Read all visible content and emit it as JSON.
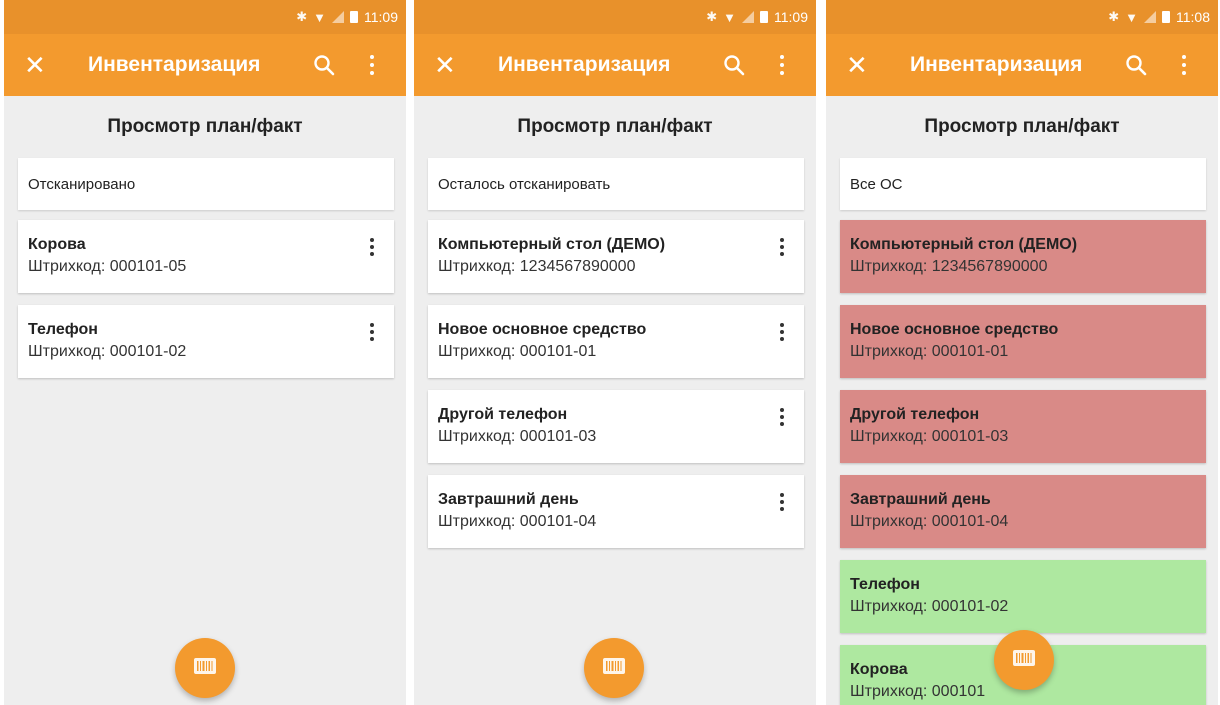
{
  "common": {
    "status_time_1": "11:09",
    "status_time_2": "11:09",
    "status_time_3": "11:08",
    "app_title": "Инвентаризация",
    "subtitle": "Просмотр план/факт",
    "icons": [
      "bluetooth-icon",
      "wifi-icon",
      "no-signal-icon",
      "battery-icon",
      "close-icon",
      "search-icon",
      "more-vert-icon",
      "barcode-scan-icon"
    ],
    "colors": {
      "accent": "#f39a2e",
      "statusbar": "#e8912b",
      "missing": "#d98a87",
      "found": "#aee8a0"
    }
  },
  "screen1": {
    "filter": "Отсканировано",
    "items": [
      {
        "name": "Корова",
        "code": "Штрихкод: 000101-05"
      },
      {
        "name": "Телефон",
        "code": "Штрихкод: 000101-02"
      }
    ]
  },
  "screen2": {
    "filter": "Осталось отсканировать",
    "items": [
      {
        "name": "Компьютерный стол (ДЕМО)",
        "code": "Штрихкод: 1234567890000"
      },
      {
        "name": "Новое основное средство",
        "code": "Штрихкод: 000101-01"
      },
      {
        "name": "Другой телефон",
        "code": "Штрихкод: 000101-03"
      },
      {
        "name": "Завтрашний день",
        "code": "Штрихкод: 000101-04"
      }
    ]
  },
  "screen3": {
    "filter": "Все ОС",
    "items": [
      {
        "name": "Компьютерный стол (ДЕМО)",
        "code": "Штрихкод: 1234567890000",
        "status": "red"
      },
      {
        "name": "Новое основное средство",
        "code": "Штрихкод: 000101-01",
        "status": "red"
      },
      {
        "name": "Другой телефон",
        "code": "Штрихкод: 000101-03",
        "status": "red"
      },
      {
        "name": "Завтрашний день",
        "code": "Штрихкод: 000101-04",
        "status": "red"
      },
      {
        "name": "Телефон",
        "code": "Штрихкод: 000101-02",
        "status": "green"
      },
      {
        "name": "Корова",
        "code": "Штрихкод: 000101",
        "status": "green"
      }
    ]
  }
}
